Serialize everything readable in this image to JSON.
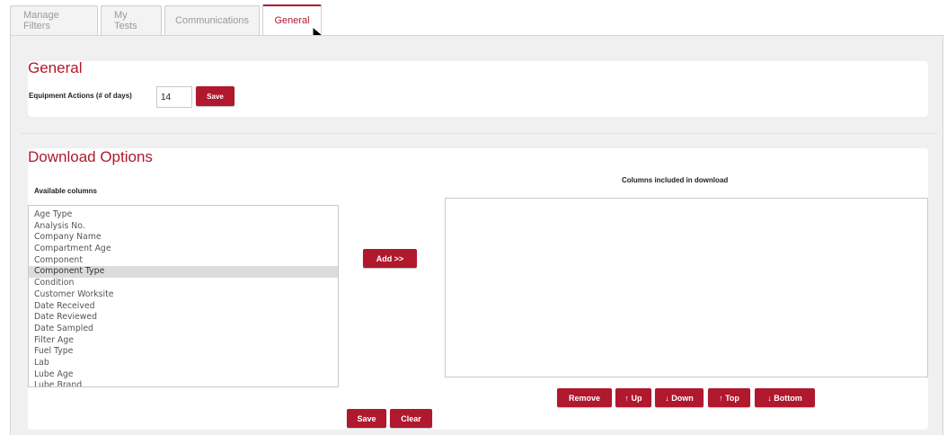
{
  "tabs": [
    {
      "label": "Manage Filters"
    },
    {
      "label": "My Tests"
    },
    {
      "label": "Communications"
    },
    {
      "label": "General"
    }
  ],
  "general": {
    "title": "General",
    "equipment_label": "Equipment Actions (# of days)",
    "days_value": "14",
    "save_label": "Save"
  },
  "download": {
    "title": "Download Options",
    "available_label": "Available columns",
    "included_label": "Columns included in download",
    "available_items": [
      "Age Type",
      "Analysis No.",
      "Company Name",
      "Compartment Age",
      "Component",
      "Component Type",
      "Condition",
      "Customer Worksite",
      "Date Received",
      "Date Reviewed",
      "Date Sampled",
      "Filter Age",
      "Fuel Type",
      "Lab",
      "Lube Age",
      "Lube Brand"
    ],
    "selected_item": "Component Type",
    "add_label": "Add >>",
    "remove_label": "Remove",
    "up_label": "↑ Up",
    "down_label": "↓ Down",
    "top_label": "↑ Top",
    "bottom_label": "↓ Bottom",
    "save_label": "Save",
    "clear_label": "Clear"
  },
  "colors": {
    "accent": "#b0182e",
    "panel_bg": "#f0f0f0"
  }
}
